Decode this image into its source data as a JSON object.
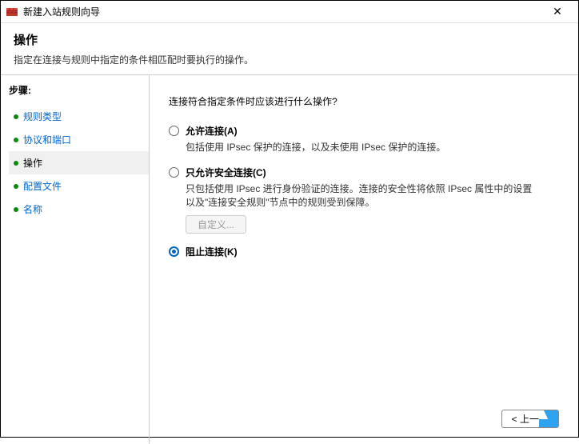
{
  "window": {
    "title": "新建入站规则向导",
    "close": "✕"
  },
  "header": {
    "title": "操作",
    "subtitle": "指定在连接与规则中指定的条件相匹配时要执行的操作。"
  },
  "sidebar": {
    "stepsLabel": "步骤:",
    "items": [
      {
        "label": "规则类型"
      },
      {
        "label": "协议和端口"
      },
      {
        "label": "操作"
      },
      {
        "label": "配置文件"
      },
      {
        "label": "名称"
      }
    ]
  },
  "main": {
    "question": "连接符合指定条件时应该进行什么操作?",
    "options": [
      {
        "label": "允许连接(A)",
        "desc": "包括使用 IPsec 保护的连接，以及未使用 IPsec 保护的连接。"
      },
      {
        "label": "只允许安全连接(C)",
        "desc": "只包括使用 IPsec 进行身份验证的连接。连接的安全性将依照 IPsec 属性中的设置以及\"连接安全规则\"节点中的规则受到保障。",
        "customize": "自定义..."
      },
      {
        "label": "阻止连接(K)"
      }
    ],
    "buttons": {
      "back": "< 上一"
    }
  }
}
